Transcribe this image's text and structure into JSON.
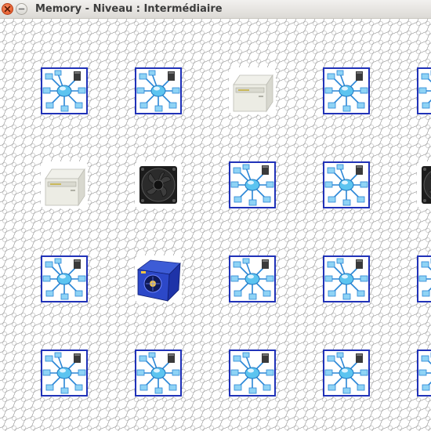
{
  "window": {
    "title": "Memory - Niveau : Intermédiaire"
  },
  "icons": {
    "close": "close-icon",
    "minimize": "minimize-icon"
  },
  "colors": {
    "card_border": "#2032b8",
    "close_button": "#e95420"
  },
  "board": {
    "rows": [
      [
        "network",
        "network",
        "optical-drive",
        "network",
        "network"
      ],
      [
        "optical-drive",
        "cooling-fan",
        "network",
        "network",
        "cooling-fan"
      ],
      [
        "network",
        "power-supply",
        "network",
        "network",
        "network"
      ],
      [
        "network",
        "network",
        "network",
        "network",
        "network"
      ]
    ]
  }
}
